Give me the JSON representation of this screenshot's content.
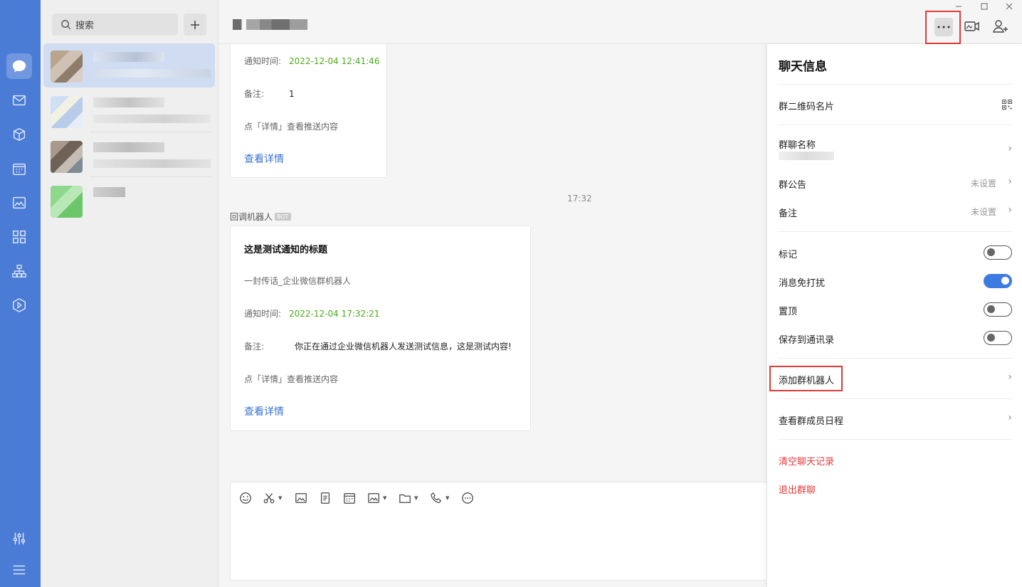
{
  "search": {
    "placeholder": "搜索"
  },
  "messages": {
    "first_card": {
      "notify_label": "通知时间:",
      "notify_time": "2022-12-04 12:41:46",
      "remark_label": "备注:",
      "remark_value": "1",
      "detail_hint": "点「详情」查看推送内容",
      "view_link": "查看详情"
    },
    "timestamp": "17:32",
    "sender_name": "回调机器人",
    "sender_badge": "BOT",
    "second_card": {
      "title": "这是测试通知的标题",
      "subtitle": "一封传话_企业微信群机器人",
      "notify_label": "通知时间:",
      "notify_time": "2022-12-04 17:32:21",
      "remark_label": "备注:",
      "remark_value": "你正在通过企业微信机器人发送测试信息，这是测试内容!",
      "detail_hint": "点「详情」查看推送内容",
      "view_link": "查看详情"
    }
  },
  "panel": {
    "title": "聊天信息",
    "qr_card": "群二维码名片",
    "group_name_label": "群聊名称",
    "announcement_label": "群公告",
    "announcement_value": "未设置",
    "remark_label": "备注",
    "remark_value": "未设置",
    "toggles": [
      {
        "label": "标记",
        "on": false
      },
      {
        "label": "消息免打扰",
        "on": true
      },
      {
        "label": "置顶",
        "on": false
      },
      {
        "label": "保存到通讯录",
        "on": false
      }
    ],
    "add_bot": "添加群机器人",
    "member_schedule": "查看群成员日程",
    "clear_history": "清空聊天记录",
    "leave_group": "退出群聊"
  },
  "colors": {
    "rail": "#4a7bd5",
    "accent": "#3e7be0",
    "green_time": "#4bab18",
    "danger": "#e03a3a",
    "link": "#3a73d2"
  }
}
